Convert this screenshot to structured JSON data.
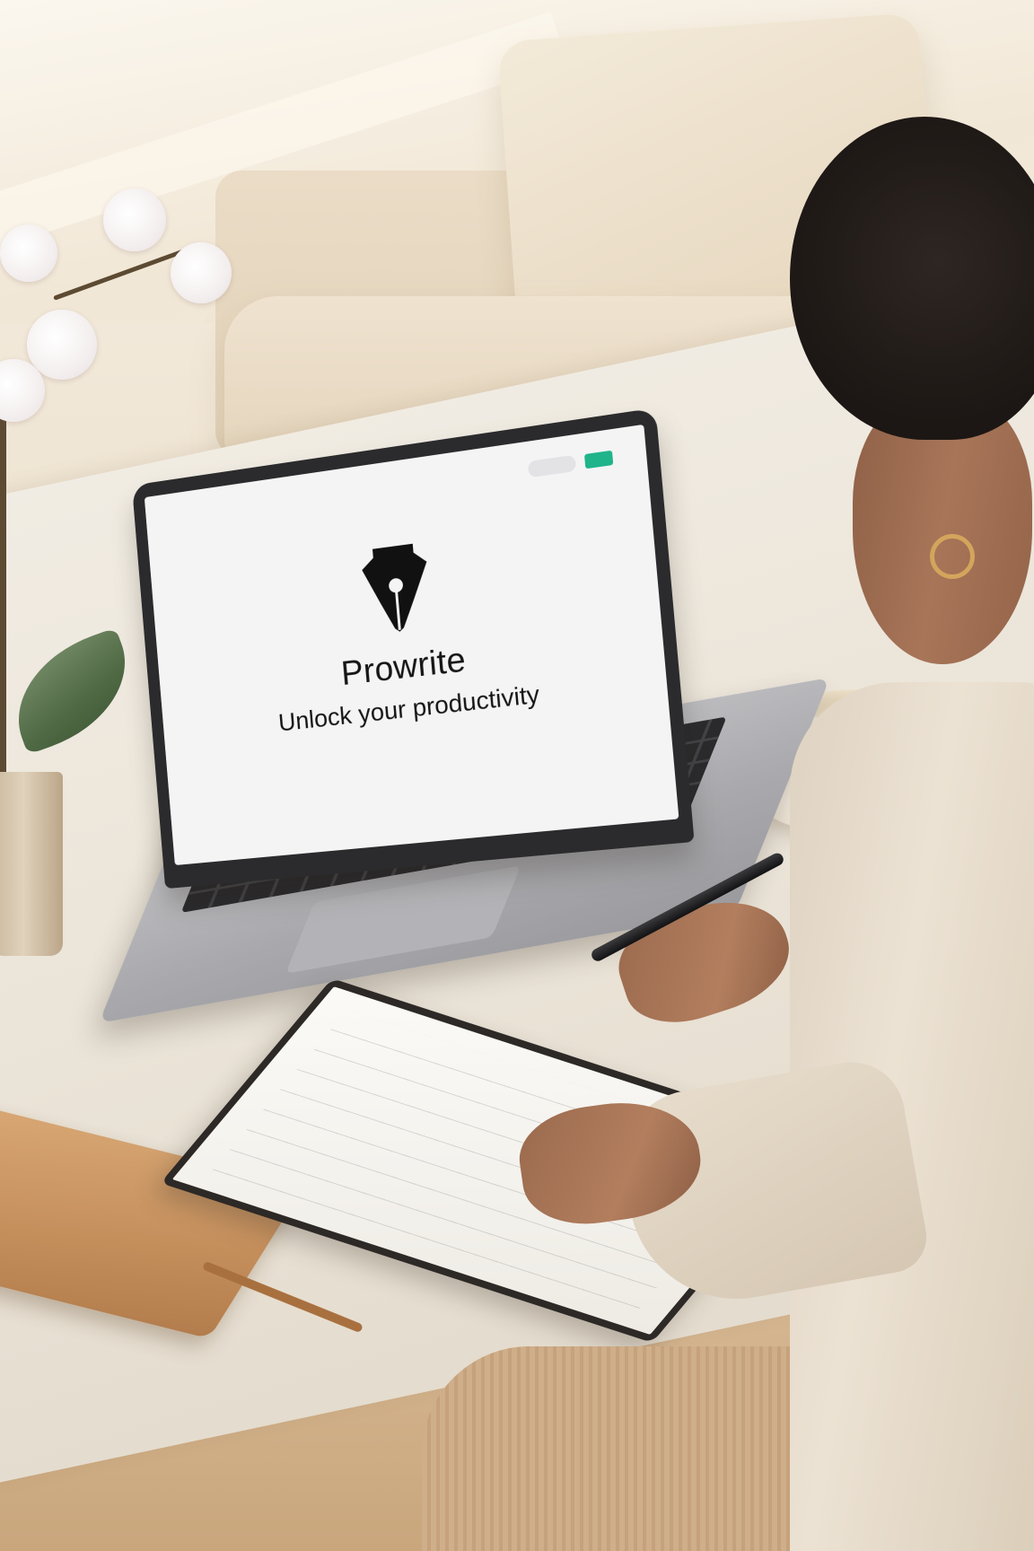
{
  "screen": {
    "nav": {
      "login_label": "",
      "signup_label": ""
    },
    "logo_icon": "fountain-pen-nib-icon",
    "brand_name": "Prowrite",
    "tagline": "Unlock your productivity"
  },
  "colors": {
    "accent": "#1fb48a",
    "text": "#151515",
    "screen_background": "#f4f4f5"
  }
}
